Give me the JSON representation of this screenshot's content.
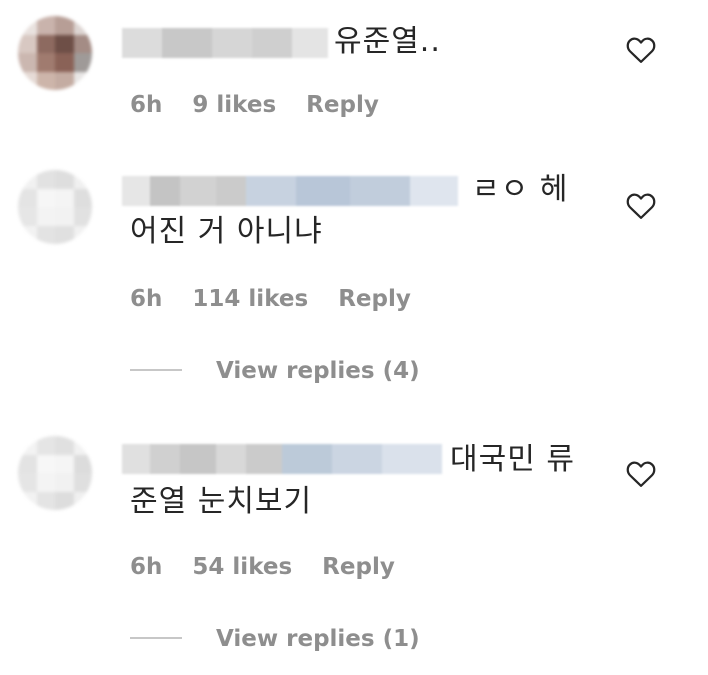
{
  "comments": [
    {
      "text_line1": "유준열..",
      "text_line2": "",
      "time": "6h",
      "likes": "9 likes",
      "reply_label": "Reply",
      "view_replies": ""
    },
    {
      "text_line1": "ㄹㅇ 헤",
      "text_line2": "어진 거 아니냐",
      "time": "6h",
      "likes": "114 likes",
      "reply_label": "Reply",
      "view_replies": "View replies (4)"
    },
    {
      "text_line1": "대국민 류",
      "text_line2": "준열 눈치보기",
      "time": "6h",
      "likes": "54 likes",
      "reply_label": "Reply",
      "view_replies": "View replies (1)"
    }
  ],
  "icons": {
    "like": "heart-outline-icon"
  },
  "colors": {
    "text": "#262626",
    "muted": "#8e8e8e",
    "divider": "#c7c7c7"
  }
}
